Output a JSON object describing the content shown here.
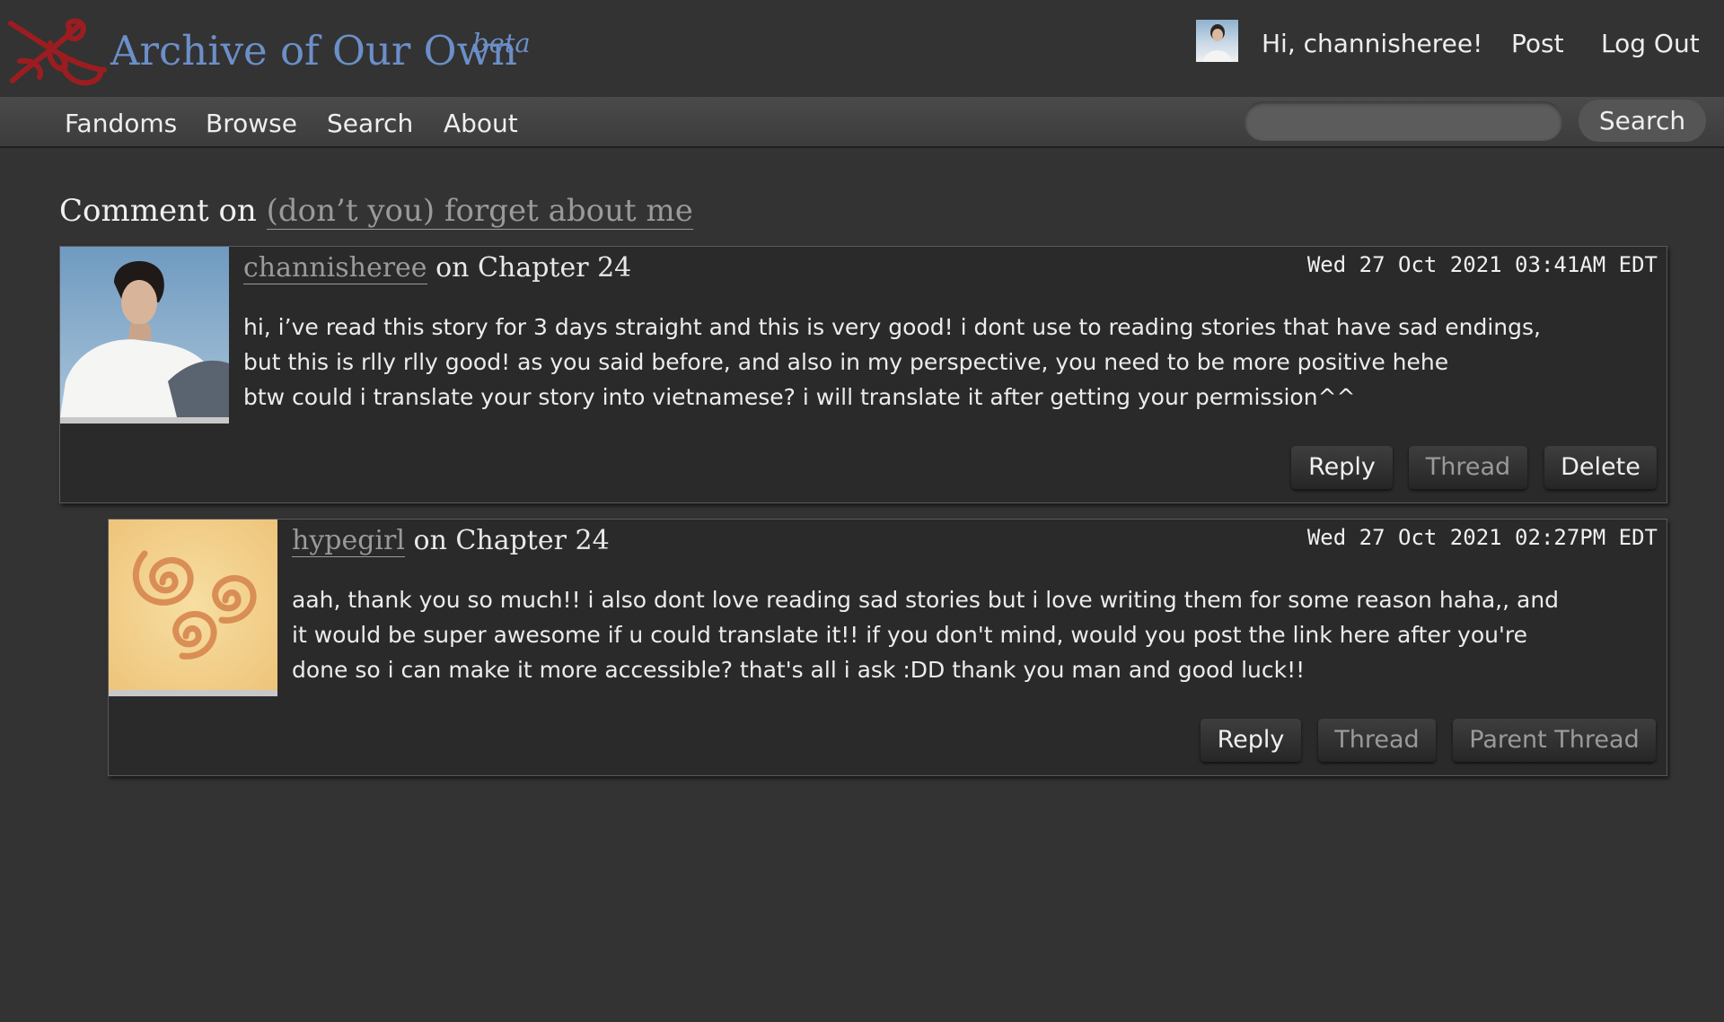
{
  "header": {
    "site_title": "Archive of Our Own",
    "site_beta": "beta",
    "greeting": "Hi, channisheree!",
    "post_label": "Post",
    "logout_label": "Log Out",
    "logo_color": "#9b1d20",
    "title_color": "#6b8fc8"
  },
  "nav": {
    "items": [
      "Fandoms",
      "Browse",
      "Search",
      "About"
    ],
    "search_button": "Search",
    "search_placeholder": ""
  },
  "page": {
    "heading_prefix": "Comment on",
    "work_title": "(don’t you) forget about me"
  },
  "comments": [
    {
      "author": "channisheree",
      "location": "on Chapter 24",
      "date": "Wed 27 Oct 2021 03:41AM EDT",
      "body_lines": [
        "hi, i’ve read this story for 3 days straight and this is very good! i dont use to reading stories that have sad endings,",
        "but this is rlly rlly good! as you said before, and also in my perspective, you need to be more positive hehe",
        "btw could i translate your story into vietnamese? i will translate it after getting your permission^^"
      ],
      "buttons": [
        "Reply",
        "Thread",
        "Delete"
      ]
    },
    {
      "author": "hypegirl",
      "location": "on Chapter 24",
      "date": "Wed 27 Oct 2021 02:27PM EDT",
      "body_lines": [
        "aah, thank you so much!! i also dont love reading sad stories but i love writing them for some reason haha,, and",
        "it would be super awesome if u could translate it!! if you don't mind, would you post the link here after you're",
        "done so i can make it more accessible? that's all i ask :DD thank you man and good luck!!"
      ],
      "buttons": [
        "Reply",
        "Thread",
        "Parent Thread"
      ]
    }
  ]
}
